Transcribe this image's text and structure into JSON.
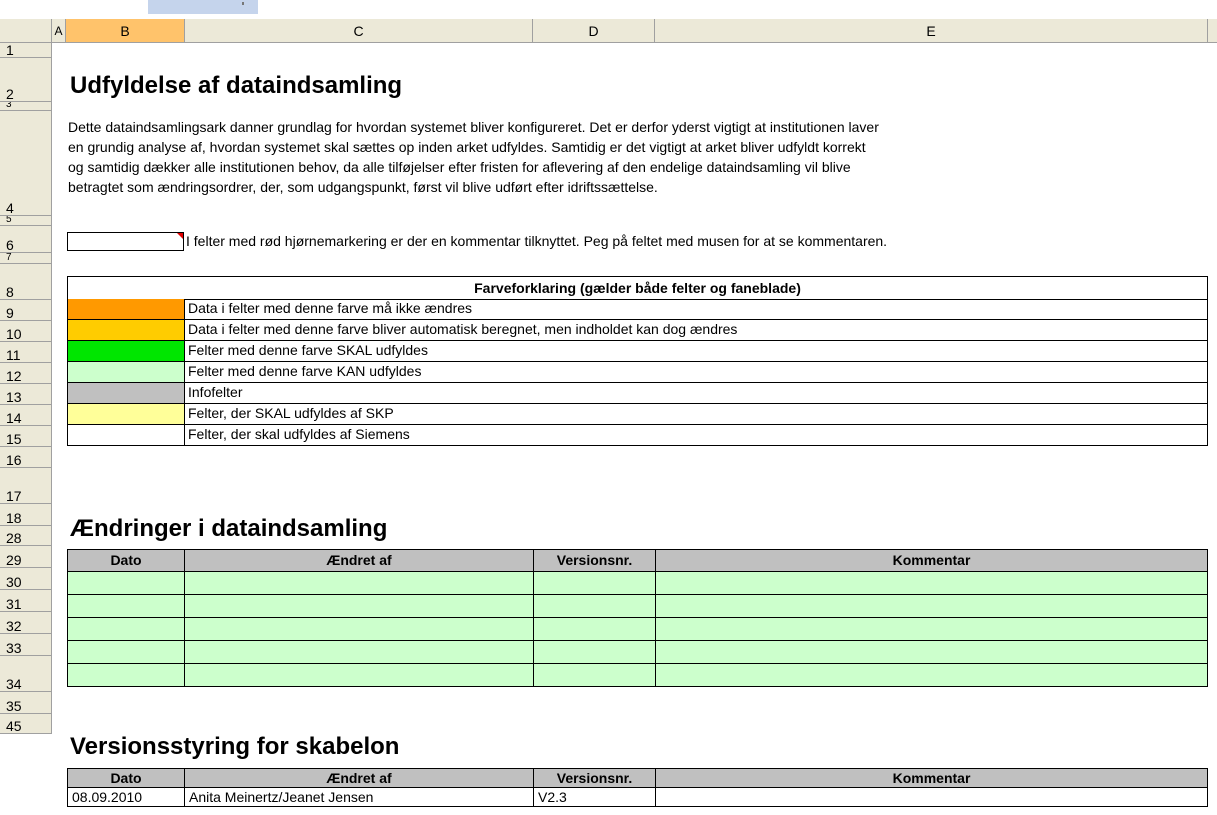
{
  "sheet": {
    "columns": [
      "A",
      "B",
      "C",
      "D",
      "E"
    ],
    "selected_column": "B",
    "rows": [
      "1",
      "2",
      "3",
      "4",
      "5",
      "6",
      "7",
      "8",
      "9",
      "10",
      "11",
      "12",
      "13",
      "14",
      "15",
      "16",
      "17",
      "18",
      "28",
      "29",
      "30",
      "31",
      "32",
      "33",
      "34",
      "35",
      "45"
    ]
  },
  "main_title": "Udfyldelse af dataindsamling",
  "intro_lines": [
    "Dette dataindsamlingsark danner grundlag for hvordan systemet bliver konfigureret. Det er derfor yderst vigtigt at institutionen laver",
    "en grundig analyse af, hvordan systemet skal sættes op inden arket udfyldes. Samtidig er det vigtigt at arket bliver udfyldt korrekt",
    "og samtidig dækker alle institutionen behov, da alle tilføjelser efter fristen for aflevering af den endelige dataindsamling vil blive",
    "betragtet som ændringsordrer, der, som udgangspunkt, først vil blive udført efter idriftssættelse."
  ],
  "comment_note": "I felter med rød hjørnemarkering er der en kommentar tilknyttet. Peg på feltet med musen for at se kommentaren.",
  "legend": {
    "title": "Farveforklaring (gælder både felter og faneblade)",
    "items": [
      {
        "color": "#ff9900",
        "text": "Data i felter med denne farve må ikke ændres"
      },
      {
        "color": "#ffcc00",
        "text": "Data i felter med denne farve bliver automatisk beregnet, men indholdet kan dog ændres"
      },
      {
        "color": "#00e600",
        "text": "Felter med denne farve SKAL udfyldes"
      },
      {
        "color": "#ccffcc",
        "text": "Felter med denne farve KAN udfyldes"
      },
      {
        "color": "#c0c0c0",
        "text": "Infofelter"
      },
      {
        "color": "#ffff99",
        "text": "Felter, der SKAL udfyldes af SKP"
      },
      {
        "color": "#ffffff",
        "text": "Felter, der skal udfyldes af Siemens"
      }
    ]
  },
  "changes": {
    "title": "Ændringer i dataindsamling",
    "headers": [
      "Dato",
      "Ændret af",
      "Versionsnr.",
      "Kommentar"
    ],
    "empty_rows": 5
  },
  "versions": {
    "title": "Versionsstyring for skabelon",
    "headers": [
      "Dato",
      "Ændret af",
      "Versionsnr.",
      "Kommentar"
    ],
    "rows": [
      [
        "08.09.2010",
        "Anita Meinertz/Jeanet Jensen",
        "V2.3",
        ""
      ]
    ]
  }
}
